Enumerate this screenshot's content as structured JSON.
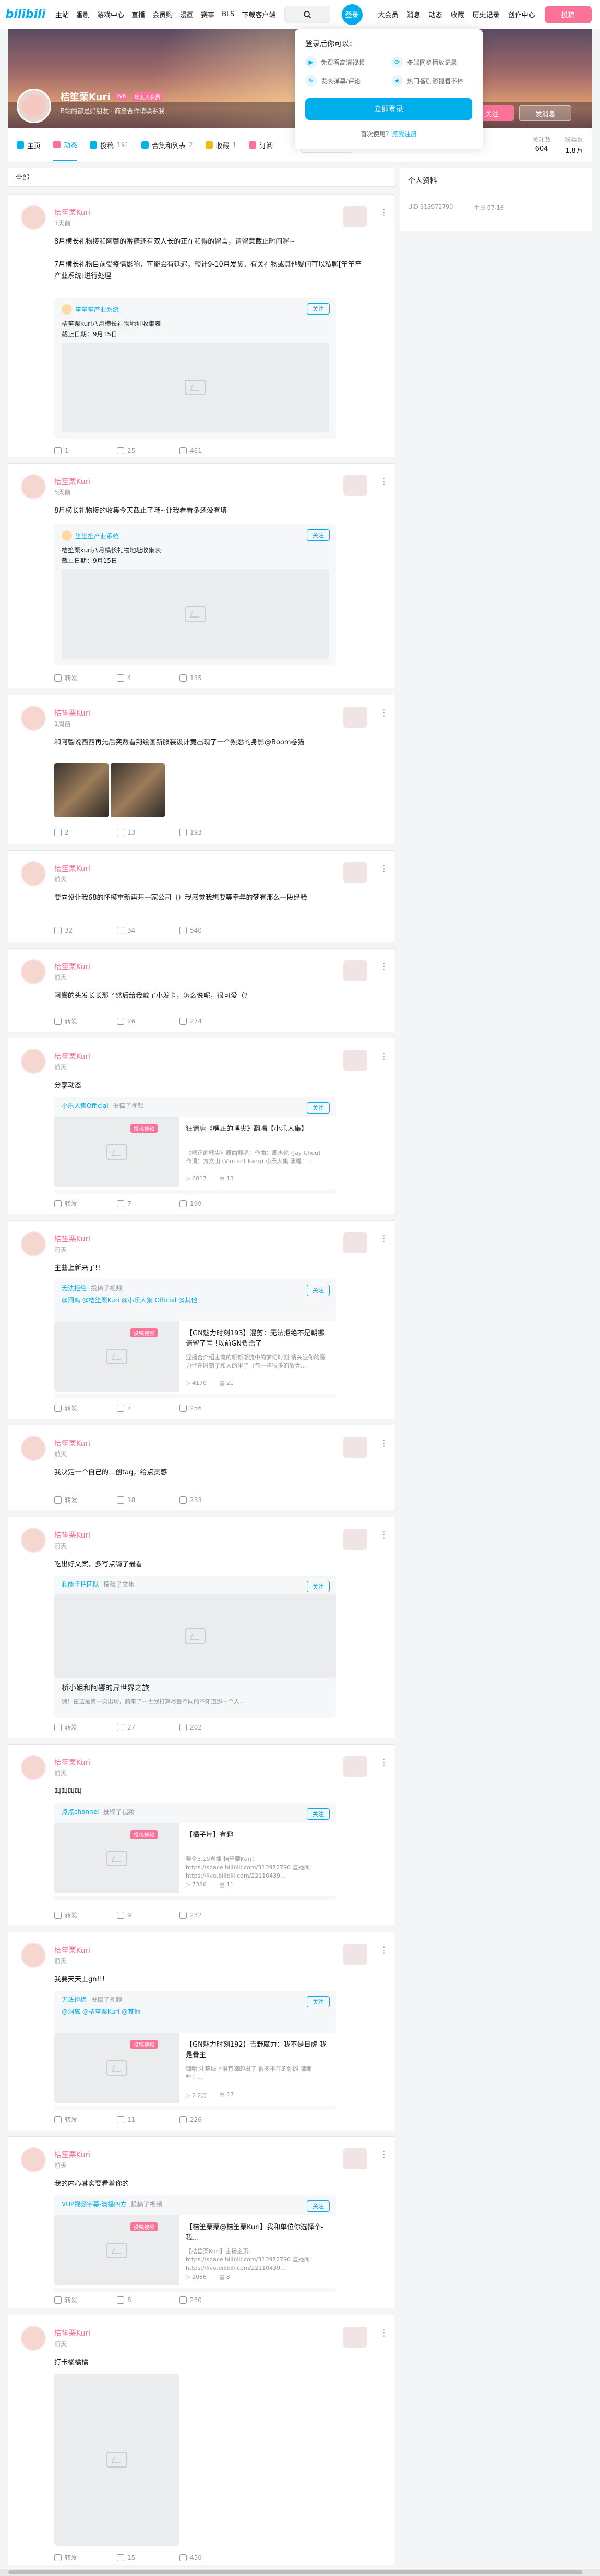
{
  "nav": {
    "logo": "bilibili",
    "links": [
      "主站",
      "番剧",
      "游戏中心",
      "直播",
      "会员购",
      "漫画",
      "赛事",
      "BLS",
      "下载客户端"
    ],
    "login": "登录",
    "right": [
      "大会员",
      "消息",
      "动态",
      "收藏",
      "历史记录",
      "创作中心"
    ],
    "upload": "投稿"
  },
  "popup": {
    "title": "登录后你可以：",
    "items": [
      "免费看高清视频",
      "多端同步播放记录",
      "发表弹幕/评论",
      "热门番剧影视看不停"
    ],
    "button": "立即登录",
    "register_prefix": "首次使用？",
    "register_link": "点我注册"
  },
  "profile": {
    "name": "桔笙栗Kuri",
    "level": "LV6",
    "vip": "年度大会员",
    "sign": "B站的都是好朋友 · 商务合作请联系我",
    "follow": "+ 关注",
    "message": "发消息"
  },
  "tabs": [
    {
      "label": "主页",
      "count": ""
    },
    {
      "label": "动态",
      "count": ""
    },
    {
      "label": "投稿",
      "count": "191"
    },
    {
      "label": "合集和列表",
      "count": "2"
    },
    {
      "label": "收藏",
      "count": "1"
    },
    {
      "label": "订阅",
      "count": ""
    }
  ],
  "tab_search": "搜索视频、动态",
  "stats": [
    {
      "label": "关注数",
      "value": "604"
    },
    {
      "label": "粉丝数",
      "value": "1.8万"
    }
  ],
  "feed_header": "全部",
  "sidebar": {
    "title": "个人资料",
    "uid_label": "UID",
    "uid": "313972790",
    "birthday_label": "生日",
    "birthday": "07-16"
  },
  "posts": [
    {
      "name": "桔笙栗Kuri",
      "time": "1天前",
      "text": "8月横长礼物接和阿響的番糖还有双人长的正在和得的留言，请留意截止时间喔~\n\n7月横长礼物目前受疫情影响，可能会有延迟，预计9-10月发货。有关礼物或其他疑问可以私聊[笙笙笙产业系统]进行处理",
      "card": {
        "author": "笙笙笙产业系统",
        "follow": "关注",
        "body": "桔笙栗kuri八月横长礼物地址收集表\n截止日期：9月15日"
      },
      "actions": [
        "1",
        "25",
        "461"
      ]
    },
    {
      "name": "桔笙栗Kuri",
      "time": "5天前",
      "text": "8月横长礼物接的收集今天截止了哦~让我看看多还没有填",
      "card": {
        "author": "笙笙笙产业系统",
        "follow": "关注",
        "body": "桔笙栗kuri八月横长礼物地址收集表\n截止日期：9月15日"
      },
      "actions": [
        "转发",
        "4",
        "135"
      ]
    },
    {
      "name": "桔笙栗Kuri",
      "time": "1周前",
      "text": "和阿響说西西再先后突然看到绘画新服装设计竟出现了一个熟悉的身影@Boom卷猫",
      "actions": [
        "2",
        "13",
        "193"
      ]
    },
    {
      "name": "桔笙栗Kuri",
      "time": "前天",
      "text": "要向设让我68的怀模重新再开一家公司（）我感觉我想要等幸年的梦有那么一段经验",
      "actions": [
        "32",
        "34",
        "540"
      ]
    },
    {
      "name": "桔笙栗Kuri",
      "time": "前天",
      "text": "阿響的头发长长那了然后给我戴了小发卡，怎么说呢，很可爱（？",
      "actions": [
        "转发",
        "26",
        "274"
      ]
    },
    {
      "name": "桔笙栗Kuri",
      "time": "前天",
      "text": "分享动态",
      "fwd": {
        "user": "小乐人集Official",
        "tag": "投稿了视频",
        "follow": "关注",
        "badge": "投稿视频",
        "title": "狂请唐《嘿正的嘿尖》翻唱【小乐人集】",
        "desc": "《嘿正的嘿尖》原曲翻唱：作曲：周杰伦 (Jay Chou)  作词：方文山 (Vincent Fang)  小乐人集 演唱：...",
        "plays": "6017",
        "danmaku": "13"
      },
      "actions": [
        "转发",
        "7",
        "199"
      ]
    },
    {
      "name": "桔笙栗Kuri",
      "time": "前天",
      "text": "主曲上新来了!!",
      "fwd": {
        "user": "无法拒绝",
        "tag": "投稿了视频",
        "follow": "关注",
        "mentions": "@洞离 @桔笙栗Kuri @小乐人集 Official @其他",
        "badge": "投稿视频",
        "title": "【GN魅力时刻193】混剪：无法拒绝不是朝哪请留了号 !以前GN负活了",
        "desc": "混播合介绍主流的新新潮流中的梦幻时刻 请关注你的魔力伴在时刻了和人的里了（包一些很多的放大...",
        "plays": "4170",
        "danmaku": "21"
      },
      "actions": [
        "转发",
        "7",
        "256"
      ]
    },
    {
      "name": "桔笙栗Kuri",
      "time": "前天",
      "text": "我决定一个自己的二创tag，给点灵感",
      "actions": [
        "转发",
        "18",
        "233"
      ]
    },
    {
      "name": "桔笙栗Kuri",
      "time": "前天",
      "text": "吃出好文案，多写点嗨子最看",
      "fwd": {
        "user": "和能手把团队",
        "tag": "投稿了文集",
        "follow": "关注",
        "title": "桥小姐和阿響的异世界之旅",
        "desc": "嗨！在这是第一次出场，前来了一世我打算尽量不同的不知道那一个人..."
      },
      "actions": [
        "转发",
        "27",
        "202"
      ]
    },
    {
      "name": "桔笙栗Kuri",
      "time": "前天",
      "text": "叫叫叫叫",
      "fwd": {
        "user": "点点channel",
        "tag": "投稿了视频",
        "follow": "关注",
        "badge": "投稿视频",
        "title": "【橘子片】有趣",
        "desc": "整合5.19直播 桔笙栗Kuri：https://space.bilibili.com/313972790 直播间：https://live.bilibili.com/22110439...",
        "plays": "7386",
        "danmaku": "11"
      },
      "actions": [
        "转发",
        "9",
        "232"
      ]
    },
    {
      "name": "桔笙栗Kuri",
      "time": "前天",
      "text": "我要天天上gn!!!",
      "fwd": {
        "user": "无法拒绝",
        "tag": "投稿了视频",
        "follow": "关注",
        "mentions": "@洞离 @桔笙栗Kuri @其他",
        "badge": "投稿视频",
        "title": "【GN魅力时刻192】吉野魔力：我不是日虎 我是骨主",
        "desc": "嗨哈 注整线上很有嗨的出了 很多不在的你的 嗨那些！...",
        "plays": "2.2万",
        "danmaku": "17"
      },
      "actions": [
        "转发",
        "11",
        "226"
      ]
    },
    {
      "name": "桔笙栗Kuri",
      "time": "前天",
      "text": "我的内心其实要看着你的",
      "fwd": {
        "user": "VUP视频字幕-澳播四方",
        "tag": "投稿了视频",
        "follow": "关注",
        "badge": "投稿视频",
        "title": "【桔笙栗栗@桔笙栗Kuri】我和单位你选择个-我...",
        "desc": "【桔笙栗Kuri】主播主页：https://space.bilibili.com/313972790 直播间：https://live.bilibili.com/22110439...",
        "plays": "2086",
        "danmaku": "3"
      },
      "actions": [
        "转发",
        "8",
        "230"
      ]
    },
    {
      "name": "桔笙栗Kuri",
      "time": "前天",
      "text": "打卡橘橘橘",
      "actions": [
        "转发",
        "15",
        "456"
      ]
    }
  ]
}
